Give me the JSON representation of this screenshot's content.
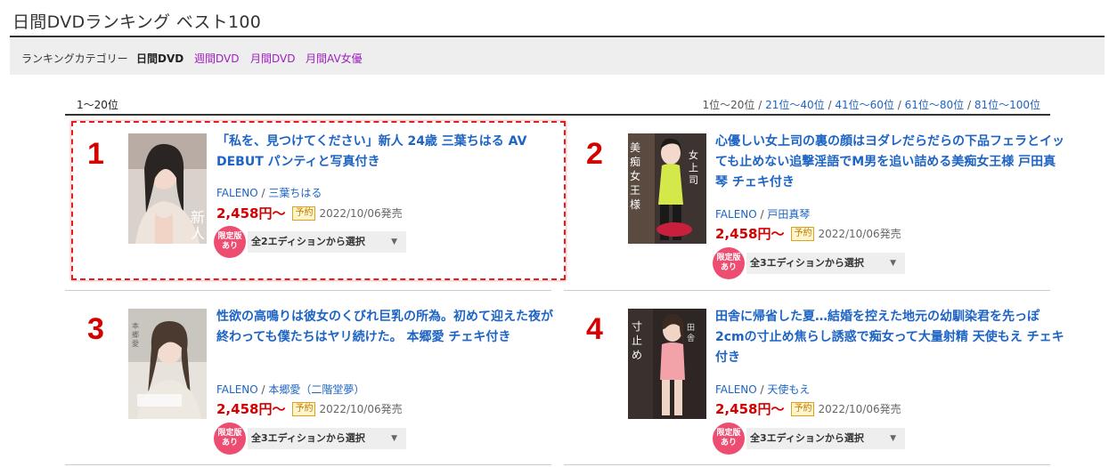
{
  "page": {
    "title": "日間DVDランキング ベスト100"
  },
  "category_bar": {
    "label": "ランキングカテゴリー",
    "current": "日間DVD",
    "links": [
      "週間DVD",
      "月間DVD",
      "月間AV女優"
    ]
  },
  "ranking": {
    "current_range": "1〜20位",
    "pager": {
      "current": "1位〜20位",
      "links": [
        "21位〜40位",
        "41位〜60位",
        "61位〜80位",
        "81位〜100位"
      ],
      "separator": "/"
    }
  },
  "items": [
    {
      "rank": "1",
      "title": "「私を、見つけてください」新人 24歳 三葉ちはる AV DEBUT パンティと写真付き",
      "maker": "FALENO",
      "actress": "三葉ちはる",
      "price": "2,458円〜",
      "preorder_badge": "予約",
      "release": "2022/10/06発売",
      "limited_badge": [
        "限定版",
        "あり"
      ],
      "edition_select": "全2エディションから選択"
    },
    {
      "rank": "2",
      "title": "心優しい女上司の裏の顔はヨダレだらだらの下品フェラとイッても止めない追撃淫語でM男を追い詰める美痴女王様 戸田真琴 チェキ付き",
      "maker": "FALENO",
      "actress": "戸田真琴",
      "price": "2,458円〜",
      "preorder_badge": "予約",
      "release": "2022/10/06発売",
      "limited_badge": [
        "限定版",
        "あり"
      ],
      "edition_select": "全3エディションから選択"
    },
    {
      "rank": "3",
      "title": "性欲の高鳴りは彼女のくびれ巨乳の所為。初めて迎えた夜が終わっても僕たちはヤリ続けた。 本郷愛 チェキ付き",
      "maker": "FALENO",
      "actress": "本郷愛（二階堂夢）",
      "price": "2,458円〜",
      "preorder_badge": "予約",
      "release": "2022/10/06発売",
      "limited_badge": [
        "限定版",
        "あり"
      ],
      "edition_select": "全3エディションから選択"
    },
    {
      "rank": "4",
      "title": "田舎に帰省した夏…結婚を控えた地元の幼馴染君を先っぽ2cmの寸止め焦らし誘惑で痴女って大量射精 天使もえ チェキ付き",
      "maker": "FALENO",
      "actress": "天使もえ",
      "price": "2,458円〜",
      "preorder_badge": "予約",
      "release": "2022/10/06発売",
      "limited_badge": [
        "限定版",
        "あり"
      ],
      "edition_select": "全3エディションから選択"
    }
  ],
  "colors": {
    "rank": "#d40000",
    "link": "#1d64c4",
    "category_link": "#a020c0",
    "limited_badge": "#ee4d72",
    "highlight_border": "#e02020"
  },
  "icons": {
    "select_caret": "▼"
  }
}
